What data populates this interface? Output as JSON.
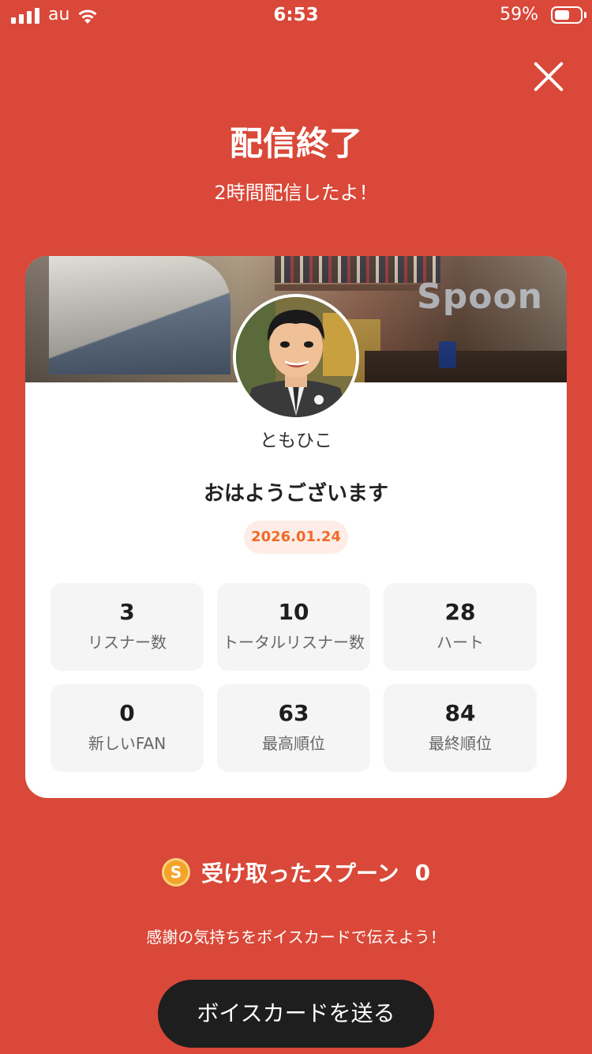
{
  "status_bar": {
    "carrier": "au",
    "time": "6:53",
    "battery_percent": "59%",
    "battery_level": 0.59
  },
  "header": {
    "title": "配信終了",
    "subtitle": "2時間配信したよ！"
  },
  "card": {
    "watermark": "Spoon",
    "username": "ともひこ",
    "live_title": "おはようございます",
    "date": "2026.01.24",
    "stats": [
      {
        "value": "3",
        "label": "リスナー数"
      },
      {
        "value": "10",
        "label": "トータルリスナー数"
      },
      {
        "value": "28",
        "label": "ハート"
      },
      {
        "value": "0",
        "label": "新しいFAN"
      },
      {
        "value": "63",
        "label": "最高順位"
      },
      {
        "value": "84",
        "label": "最終順位"
      }
    ]
  },
  "spoons": {
    "icon_letter": "S",
    "label": "受け取ったスプーン",
    "count": "0"
  },
  "footer": {
    "message": "感謝の気持ちをボイスカードで伝えよう！",
    "button_label": "ボイスカードを送る"
  },
  "colors": {
    "background": "#D94838",
    "date_badge_text": "#F06A2A",
    "coin": "#F6A32A",
    "button": "#1E1E1E"
  }
}
